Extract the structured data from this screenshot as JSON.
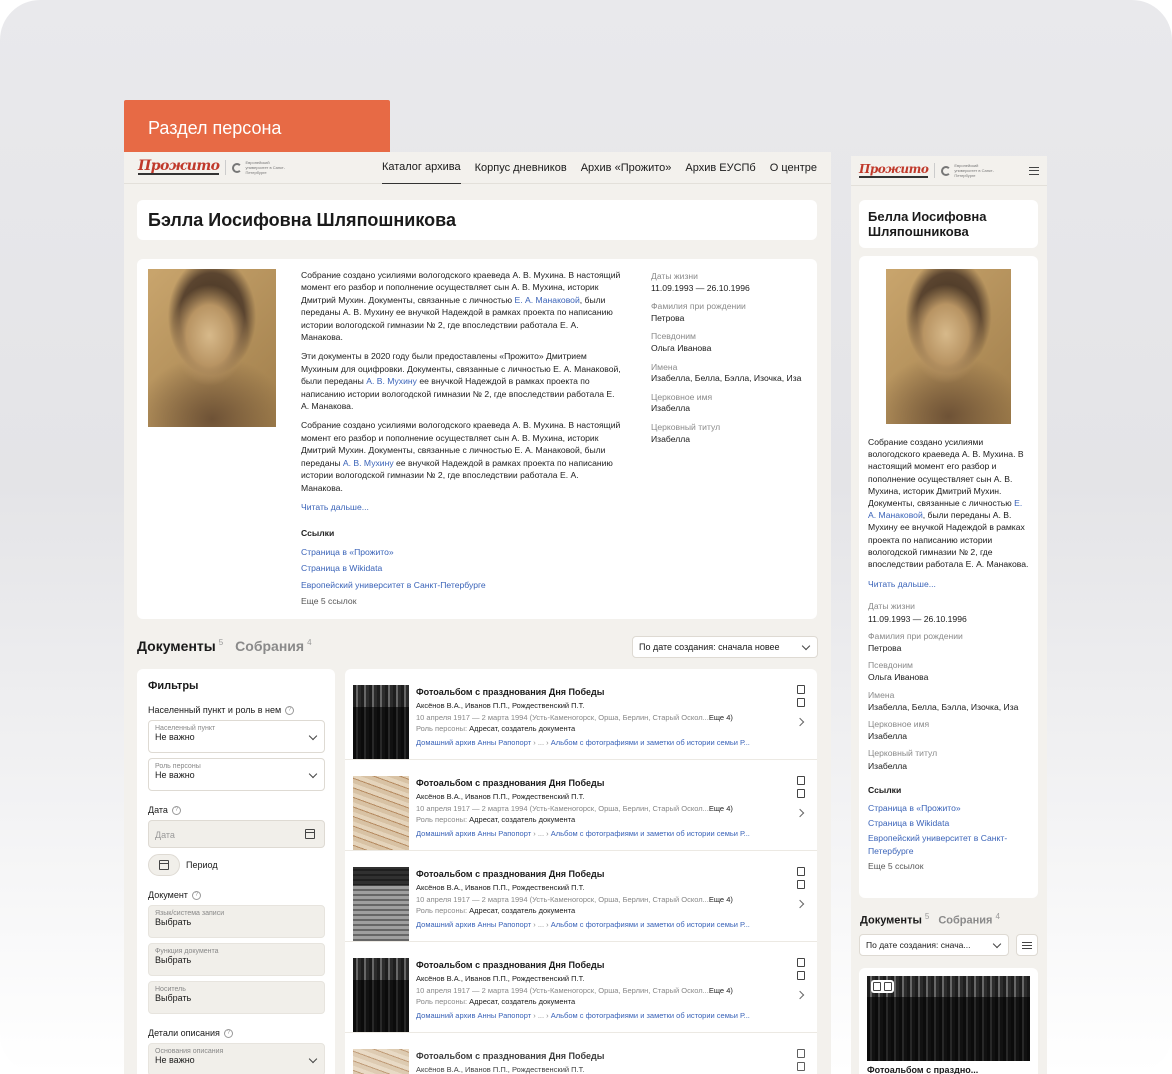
{
  "section_label": "Раздел персона",
  "brand": {
    "logo": "Прожито",
    "partner": "Европейский университет в Санкт-Петербурге"
  },
  "nav": [
    "Каталог архива",
    "Корпус дневников",
    "Архив «Прожито»",
    "Архив ЕУСПб",
    "О центре"
  ],
  "person": {
    "name_desktop": "Бэлла Иосифовна Шляпошникова",
    "name_mobile": "Белла Иосифовна Шляпошникова",
    "desc": [
      [
        "Собрание создано усилиями вологодского краеведа А. В. Мухина. В настоящий момент его разбор и пополнение осуществляет сын А. В. Мухина, историк Дмитрий Мухин. Документы, связанные с личностью ",
        "Е. А. Манаковой",
        ", были переданы А. В. Мухину ее внучкой Надеждой в рамках проекта по написанию истории вологодской гимназии № 2, где впоследствии работала Е. А. Манакова."
      ],
      [
        "Эти документы в 2020 году были предоставлены «Прожито» Дмитрием Мухиным для оцифровки. Документы, связанные с личностью Е. А. Манаковой, были переданы ",
        "А. В. Мухину",
        " ее внучкой Надеждой в рамках проекта по написанию истории вологодской гимназии № 2, где впоследствии работала Е. А. Манакова."
      ],
      [
        "Собрание создано усилиями вологодского краеведа А. В. Мухина. В настоящий момент его разбор и пополнение осуществляет сын А. В. Мухина, историк Дмитрий Мухин. Документы, связанные с личностью Е. А. Манаковой, были переданы ",
        "А. В. Мухину",
        " ее внучкой Надеждой в рамках проекта по написанию истории вологодской гимназии № 2, где впоследствии работала Е. А. Манакова."
      ]
    ],
    "mobile_desc": [
      "Собрание создано усилиями вологодского краеведа А. В. Мухина. В настоящий момент его разбор и пополнение осуществляет сын А. В. Мухина, историк Дмитрий Мухин. Документы, связанные с личностью ",
      "Е. А. Манаковой",
      ", были переданы А. В. Мухину ее внучкой Надеждой в рамках проекта по написанию истории вологодской гимназии № 2, где впоследствии работала Е. А. Манакова."
    ],
    "read_more": "Читать дальше...",
    "links_title": "Ссылки",
    "links": [
      "Страница в «Прожито»",
      "Страница в Wikidata",
      "Европейский университет в Санкт-Петербурге"
    ],
    "links_more": "Еще 5 ссылок",
    "facts": [
      {
        "label": "Даты жизни",
        "value": "11.09.1993 — 26.10.1996"
      },
      {
        "label": "Фамилия при рождении",
        "value": "Петрова"
      },
      {
        "label": "Псевдоним",
        "value": "Ольга Иванова"
      },
      {
        "label": "Имена",
        "value": "Изабелла, Белла, Бэлла, Изочка, Иза"
      },
      {
        "label": "Церковное имя",
        "value": "Изабелла"
      },
      {
        "label": "Церковный титул",
        "value": "Изабелла"
      }
    ]
  },
  "tabs": [
    {
      "label": "Документы",
      "count": "5"
    },
    {
      "label": "Собрания",
      "count": "4"
    }
  ],
  "sort": {
    "desktop": "По дате создания: сначала новее",
    "mobile": "По дате создания: снача..."
  },
  "filters": {
    "title": "Фильтры",
    "place_section": "Населенный пункт и роль в нем",
    "place_label": "Населенный пункт",
    "place_value": "Не важно",
    "role_label": "Роль персоны",
    "role_value": "Не важно",
    "date_section": "Дата",
    "date_placeholder": "Дата",
    "period": "Период",
    "doc_section": "Документ",
    "lang_label": "Язык/система записи",
    "lang_value": "Выбрать",
    "func_label": "Функция документа",
    "func_value": "Выбрать",
    "carrier_label": "Носитель",
    "carrier_value": "Выбрать",
    "details_section": "Детали описания",
    "basis_label": "Основания описания",
    "basis_value": "Не важно"
  },
  "doc": {
    "title": "Фотоальбом с празднования Дня Победы",
    "authors": "Аксёнов В.А., Иванов П.П., Рождественский П.Т.",
    "dates": "10 апреля 1917 — 2 марта 1994 (Усть-Каменогорск, Орша, Берлин, Старый Оскол...",
    "dates_more": "Еще 4)",
    "role_label": "Роль персоны:",
    "role_value": "Адресат, создатель документа",
    "crumb1": "Домашний архив Анны Рапопорт",
    "crumb_sep": "›  ...  ›",
    "crumb2": "Альбом с фотографиями и заметки об истории семьи Р...",
    "mobile_title": "Фотоальбом с праздно..."
  }
}
